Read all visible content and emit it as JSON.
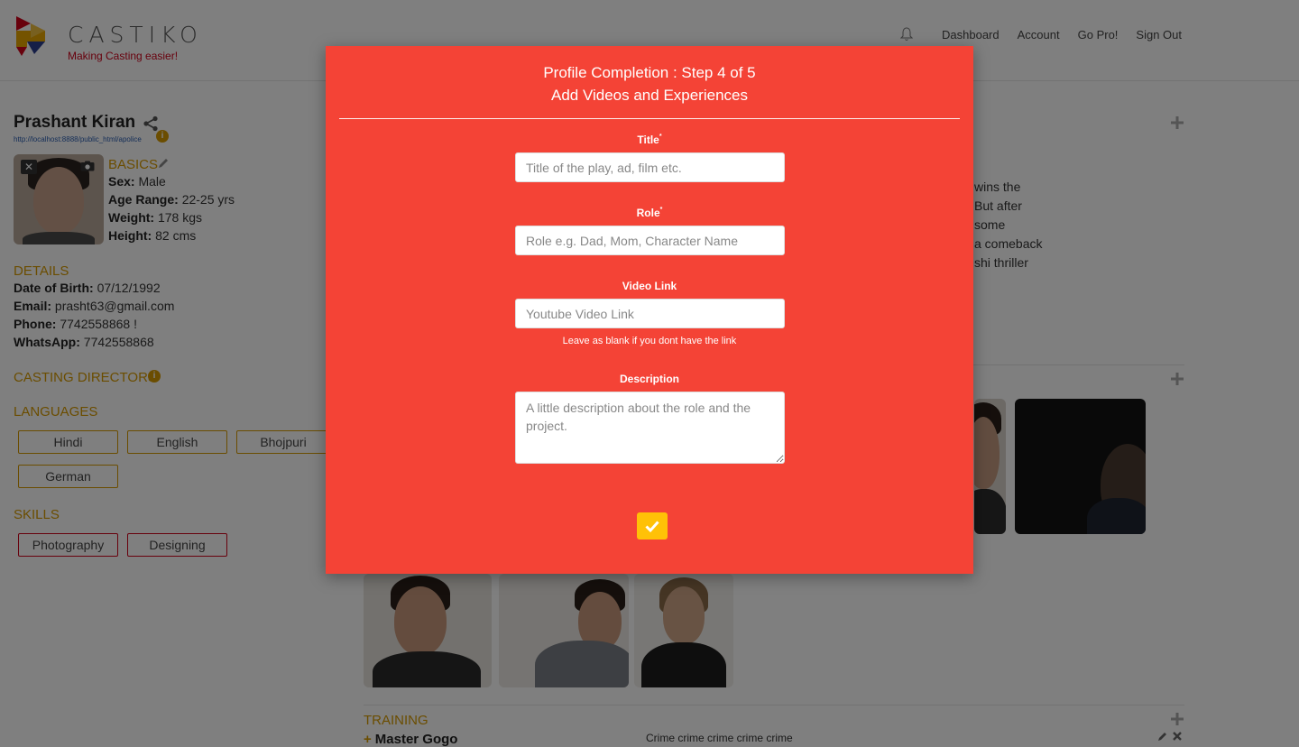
{
  "header": {
    "brand_name": "CASTIKO",
    "tagline": "Making Casting easier!",
    "nav": [
      "Dashboard",
      "Account",
      "Go Pro!",
      "Sign Out"
    ]
  },
  "profile": {
    "name": "Prashant Kiran",
    "url": "http://localhost:8888/public_html/apolice",
    "basics_title": "BASICS",
    "basics": [
      {
        "label": "Sex:",
        "value": "Male"
      },
      {
        "label": "Age Range:",
        "value": "22-25 yrs"
      },
      {
        "label": "Weight:",
        "value": "178 kgs"
      },
      {
        "label": "Height:",
        "value": "82 cms"
      }
    ],
    "details_title": "DETAILS",
    "details": [
      {
        "label": "Date of Birth:",
        "value": "07/12/1992"
      },
      {
        "label": "Email:",
        "value": "prasht63@gmail.com"
      },
      {
        "label": "Phone:",
        "value": "7742558868 !"
      },
      {
        "label": "WhatsApp:",
        "value": "7742558868"
      }
    ],
    "casting_directors_title": "CASTING DIRECTORS",
    "languages_title": "LANGUAGES",
    "languages": [
      "Hindi",
      "English",
      "Bhojpuri",
      "German"
    ],
    "skills_title": "SKILLS",
    "skills": [
      "Photography",
      "Designing"
    ]
  },
  "bio_fragments": [
    "wins the",
    "But after",
    "some",
    "a comeback",
    "shi thriller"
  ],
  "training": {
    "title": "TRAINING",
    "item": "Master Gogo",
    "description": "Crime crime crime crime crime"
  },
  "modal": {
    "title_line1": "Profile Completion : Step 4 of 5",
    "title_line2": "Add Videos and Experiences",
    "fields": {
      "title": {
        "label": "Title",
        "required_mark": "*",
        "placeholder": "Title of the play, ad, film etc."
      },
      "role": {
        "label": "Role",
        "required_mark": "*",
        "placeholder": "Role e.g. Dad, Mom, Character Name"
      },
      "video_link": {
        "label": "Video Link",
        "placeholder": "Youtube Video Link",
        "help": "Leave as blank if you dont have the link"
      },
      "description": {
        "label": "Description",
        "placeholder": "A little description about the role and the project."
      }
    },
    "submit_icon": "check-icon"
  },
  "colors": {
    "modal_bg": "#f44336",
    "accent": "#d69a00",
    "brand_red": "#d0021b",
    "submit": "#ffc107"
  }
}
